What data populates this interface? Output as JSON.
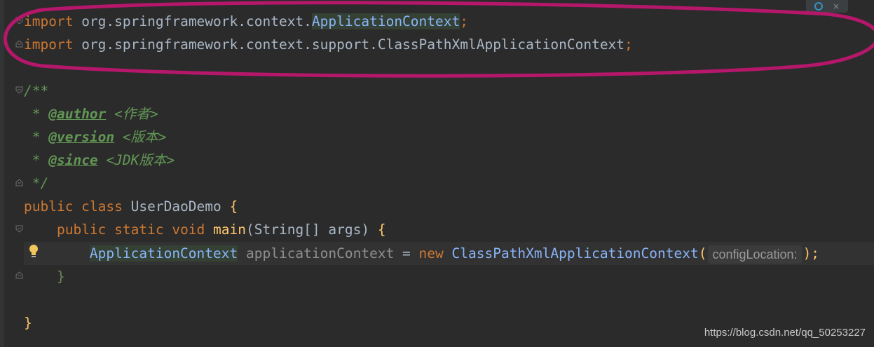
{
  "code": {
    "line1": {
      "kw": "import",
      "pkg": " org.springframework.context.",
      "cls": "ApplicationContext",
      "end": ";"
    },
    "line2": {
      "kw": "import",
      "pkg": " org.springframework.context.support.ClassPathXmlApplicationContext",
      "end": ";"
    },
    "doc_open": "/**",
    "doc_author": {
      "star": " * ",
      "tag": "@author",
      "val": " <作者>"
    },
    "doc_version": {
      "star": " * ",
      "tag": "@version",
      "val": " <版本>"
    },
    "doc_since": {
      "star": " * ",
      "tag": "@since",
      "val": " <JDK版本>"
    },
    "doc_close": " */",
    "class_decl": {
      "kw": "public class ",
      "name": "UserDaoDemo",
      "open": " {"
    },
    "method_decl": {
      "kw": "public static void ",
      "name": "main",
      "params": "(String[] args) ",
      "open": "{"
    },
    "stmt": {
      "type": "ApplicationContext",
      "var": " applicationContext",
      "eq": " = ",
      "new": "new ",
      "cls": "ClassPathXmlApplicationContext",
      "paren": "(",
      "hint": "configLocation:",
      "close": ");"
    },
    "method_close": "}",
    "class_close": "}"
  },
  "watermark": "https://blog.csdn.net/qq_50253227",
  "colors": {
    "annotation": "#b5176a",
    "background": "#2b2b2b"
  },
  "icons": {
    "bulb": "lightbulb-icon",
    "fold": "fold-marker-icon",
    "widget": "reload-icon"
  }
}
